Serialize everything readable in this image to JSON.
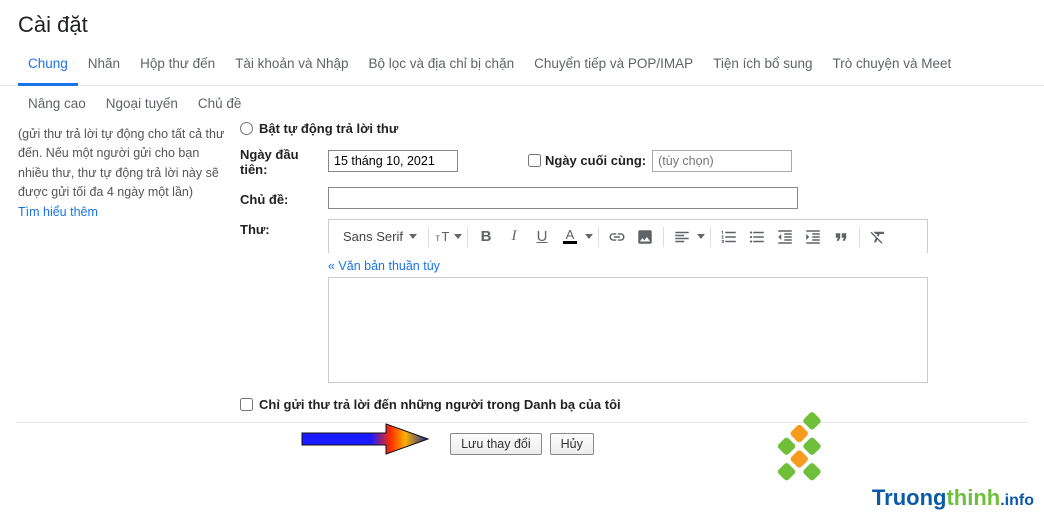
{
  "title": "Cài đặt",
  "tabs": {
    "row1": [
      "Chung",
      "Nhãn",
      "Hộp thư đến",
      "Tài khoản và Nhập",
      "Bộ lọc và địa chỉ bị chặn",
      "Chuyển tiếp và POP/IMAP",
      "Tiện ích bổ sung",
      "Trò chuyện và Meet"
    ],
    "row2": [
      "Nâng cao",
      "Ngoại tuyến",
      "Chủ đề"
    ],
    "active": "Chung"
  },
  "left": {
    "desc": "(gửi thư trả lời tự động cho tất cả thư đến. Nếu một người gửi cho bạn nhiều thư, thư tự động trả lời này sẽ được gửi tối đa 4 ngày một lần)",
    "learn_more": "Tìm hiểu thêm"
  },
  "vacation": {
    "enable_label": "Bật tự động trả lời thư",
    "first_day_label": "Ngày đầu tiên:",
    "first_day_value": "15 tháng 10, 2021",
    "last_day_label": "Ngày cuối cùng:",
    "last_day_placeholder": "(tùy chọn)",
    "subject_label": "Chủ đề:",
    "subject_value": "",
    "body_label": "Thư:",
    "font_name": "Sans Serif",
    "plain_text_link": "« Văn bản thuần túy",
    "contacts_only": "Chỉ gửi thư trả lời đến những người trong Danh bạ của tôi"
  },
  "actions": {
    "save": "Lưu thay đổi",
    "cancel": "Hủy"
  },
  "watermark": {
    "t1": "Truong",
    "t2": "thinh",
    "suffix": ".info"
  }
}
